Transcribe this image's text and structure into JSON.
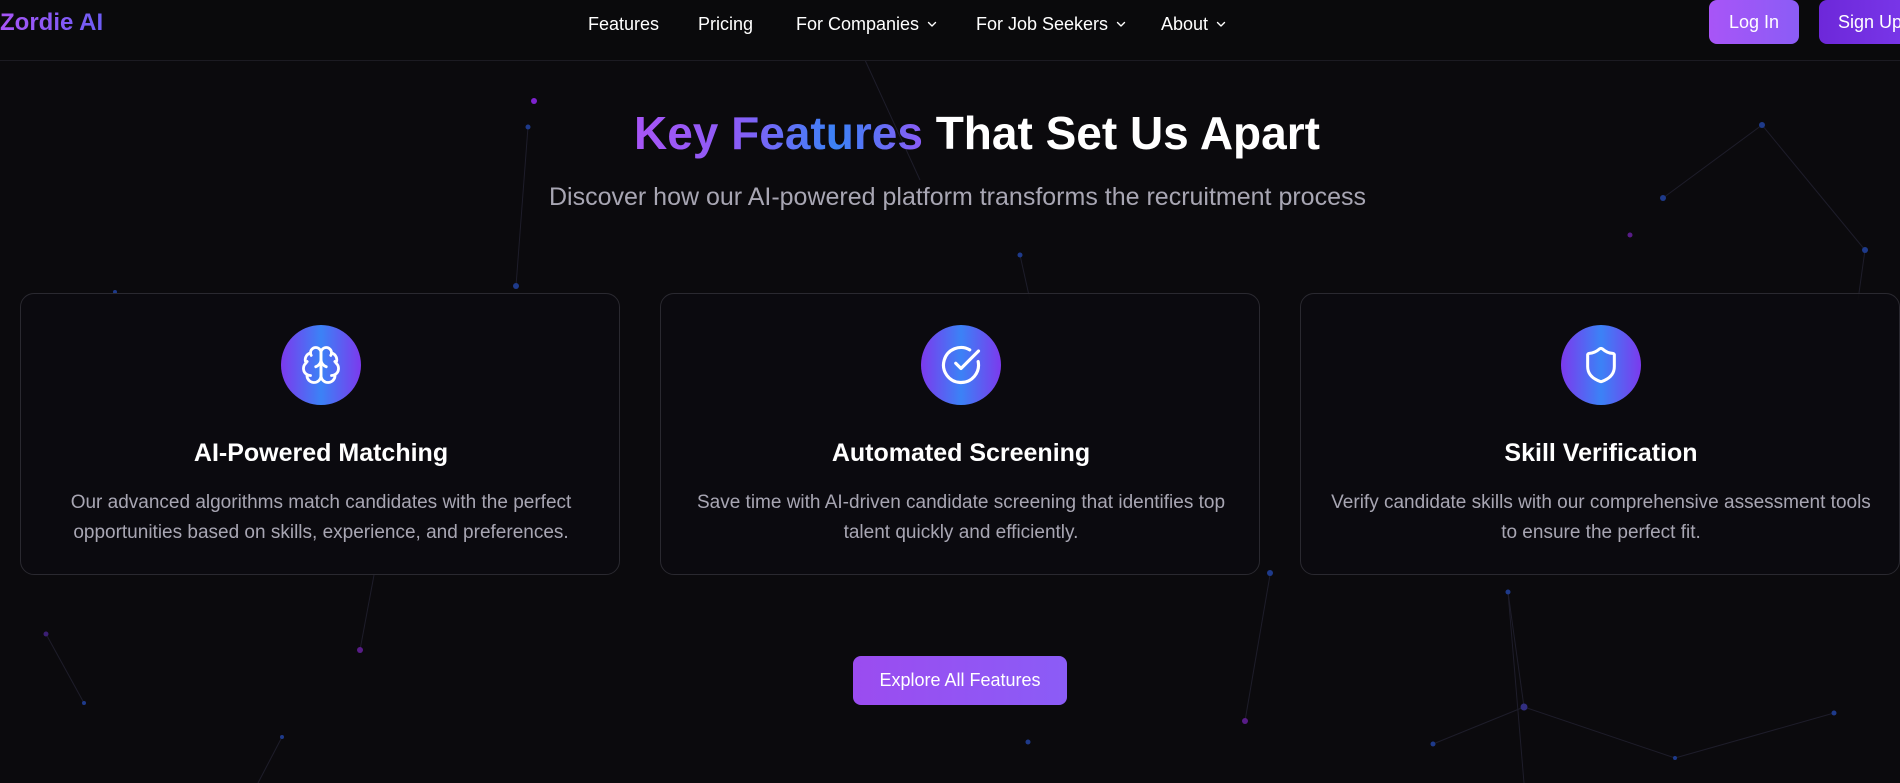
{
  "brand": {
    "name": "Zordie AI",
    "accent_purple": "#a855f7",
    "accent_blue": "#3b82f6",
    "background": "#0b0a0d"
  },
  "nav": {
    "links": [
      {
        "label": "Features",
        "has_dropdown": false
      },
      {
        "label": "Pricing",
        "has_dropdown": false
      },
      {
        "label": "For Companies",
        "has_dropdown": true
      },
      {
        "label": "For Job Seekers",
        "has_dropdown": true
      },
      {
        "label": "About",
        "has_dropdown": true
      }
    ],
    "login_label": "Log In",
    "signup_label": "Sign Up"
  },
  "hero": {
    "title_highlight": "Key Features",
    "title_rest": " That Set Us Apart",
    "subtitle": "Discover how our AI-powered platform transforms the recruitment process"
  },
  "features": [
    {
      "icon": "brain-icon",
      "title": "AI-Powered Matching",
      "description": "Our advanced algorithms match candidates with the perfect opportunities based on skills, experience, and preferences."
    },
    {
      "icon": "check-circle-icon",
      "title": "Automated Screening",
      "description": "Save time with AI-driven candidate screening that identifies top talent quickly and efficiently."
    },
    {
      "icon": "shield-icon",
      "title": "Skill Verification",
      "description": "Verify candidate skills with our comprehensive assessment tools to ensure the perfect fit."
    }
  ],
  "cta": {
    "label": "Explore All Features"
  }
}
